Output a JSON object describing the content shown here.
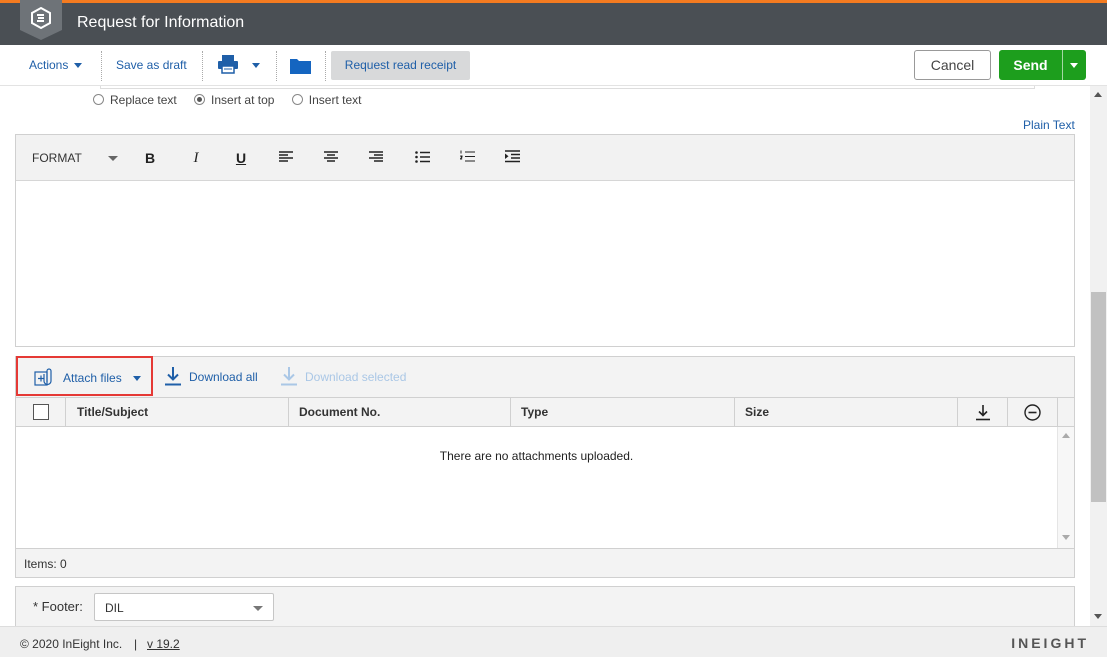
{
  "header": {
    "title": "Request for Information",
    "accent": "#f47b20",
    "bg": "#4a4f54"
  },
  "toolbar": {
    "actions_label": "Actions",
    "save_draft_label": "Save as draft",
    "request_read_receipt_label": "Request read receipt",
    "cancel_label": "Cancel",
    "send_label": "Send"
  },
  "reply_options": [
    {
      "label": "Replace text",
      "selected": false
    },
    {
      "label": "Insert at top",
      "selected": true
    },
    {
      "label": "Insert text",
      "selected": false
    }
  ],
  "editor": {
    "plain_text_link": "Plain Text",
    "format_label": "FORMAT"
  },
  "attachments": {
    "attach_label": "Attach files",
    "download_all_label": "Download all",
    "download_selected_label": "Download selected",
    "columns": [
      "Title/Subject",
      "Document No.",
      "Type",
      "Size"
    ],
    "empty_message": "There are no attachments uploaded.",
    "items_count": "Items: 0"
  },
  "footer_field": {
    "label": "* Footer:",
    "value": "DIL"
  },
  "statusbar": {
    "copyright": "© 2020 InEight Inc.",
    "separator": "|",
    "version": "v 19.2",
    "brand": "INEIGHT"
  }
}
